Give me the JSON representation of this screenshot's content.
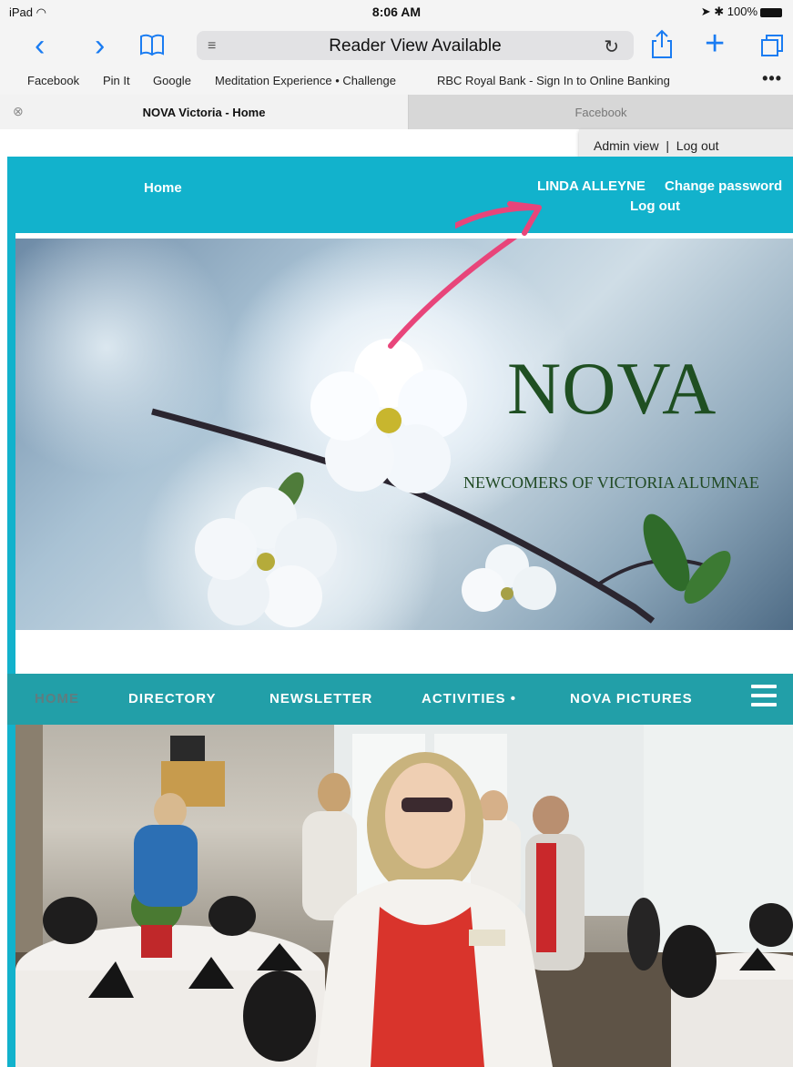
{
  "status_bar": {
    "device": "iPad",
    "time": "8:06 AM",
    "battery": "100%"
  },
  "toolbar": {
    "url_text": "Reader View Available"
  },
  "bookmarks": [
    "Facebook",
    "Pin It",
    "Google",
    "Meditation Experience • Challenge",
    "RBC Royal Bank - Sign In to Online Banking"
  ],
  "tabs": {
    "active": "NOVA Victoria - Home",
    "inactive": "Facebook"
  },
  "admin": {
    "admin_view": "Admin view",
    "separator": "|",
    "log_out": "Log out"
  },
  "header": {
    "home": "Home",
    "user": "LINDA ALLEYNE",
    "change_password": "Change password",
    "log_out": "Log out"
  },
  "hero": {
    "title": "NOVA",
    "subtitle": "NEWCOMERS OF VICTORIA ALUMNAE"
  },
  "nav": {
    "items": [
      "HOME",
      "DIRECTORY",
      "NEWSLETTER",
      "ACTIVITIES",
      "NOVA PICTURES"
    ],
    "activities_dot": "•"
  },
  "colors": {
    "teal_header": "#12b2cc",
    "nav_teal": "#229fa8",
    "nova_green": "#1f4f22",
    "annotation_arrow": "#e8457a",
    "ios_blue": "#1a7cf2"
  }
}
